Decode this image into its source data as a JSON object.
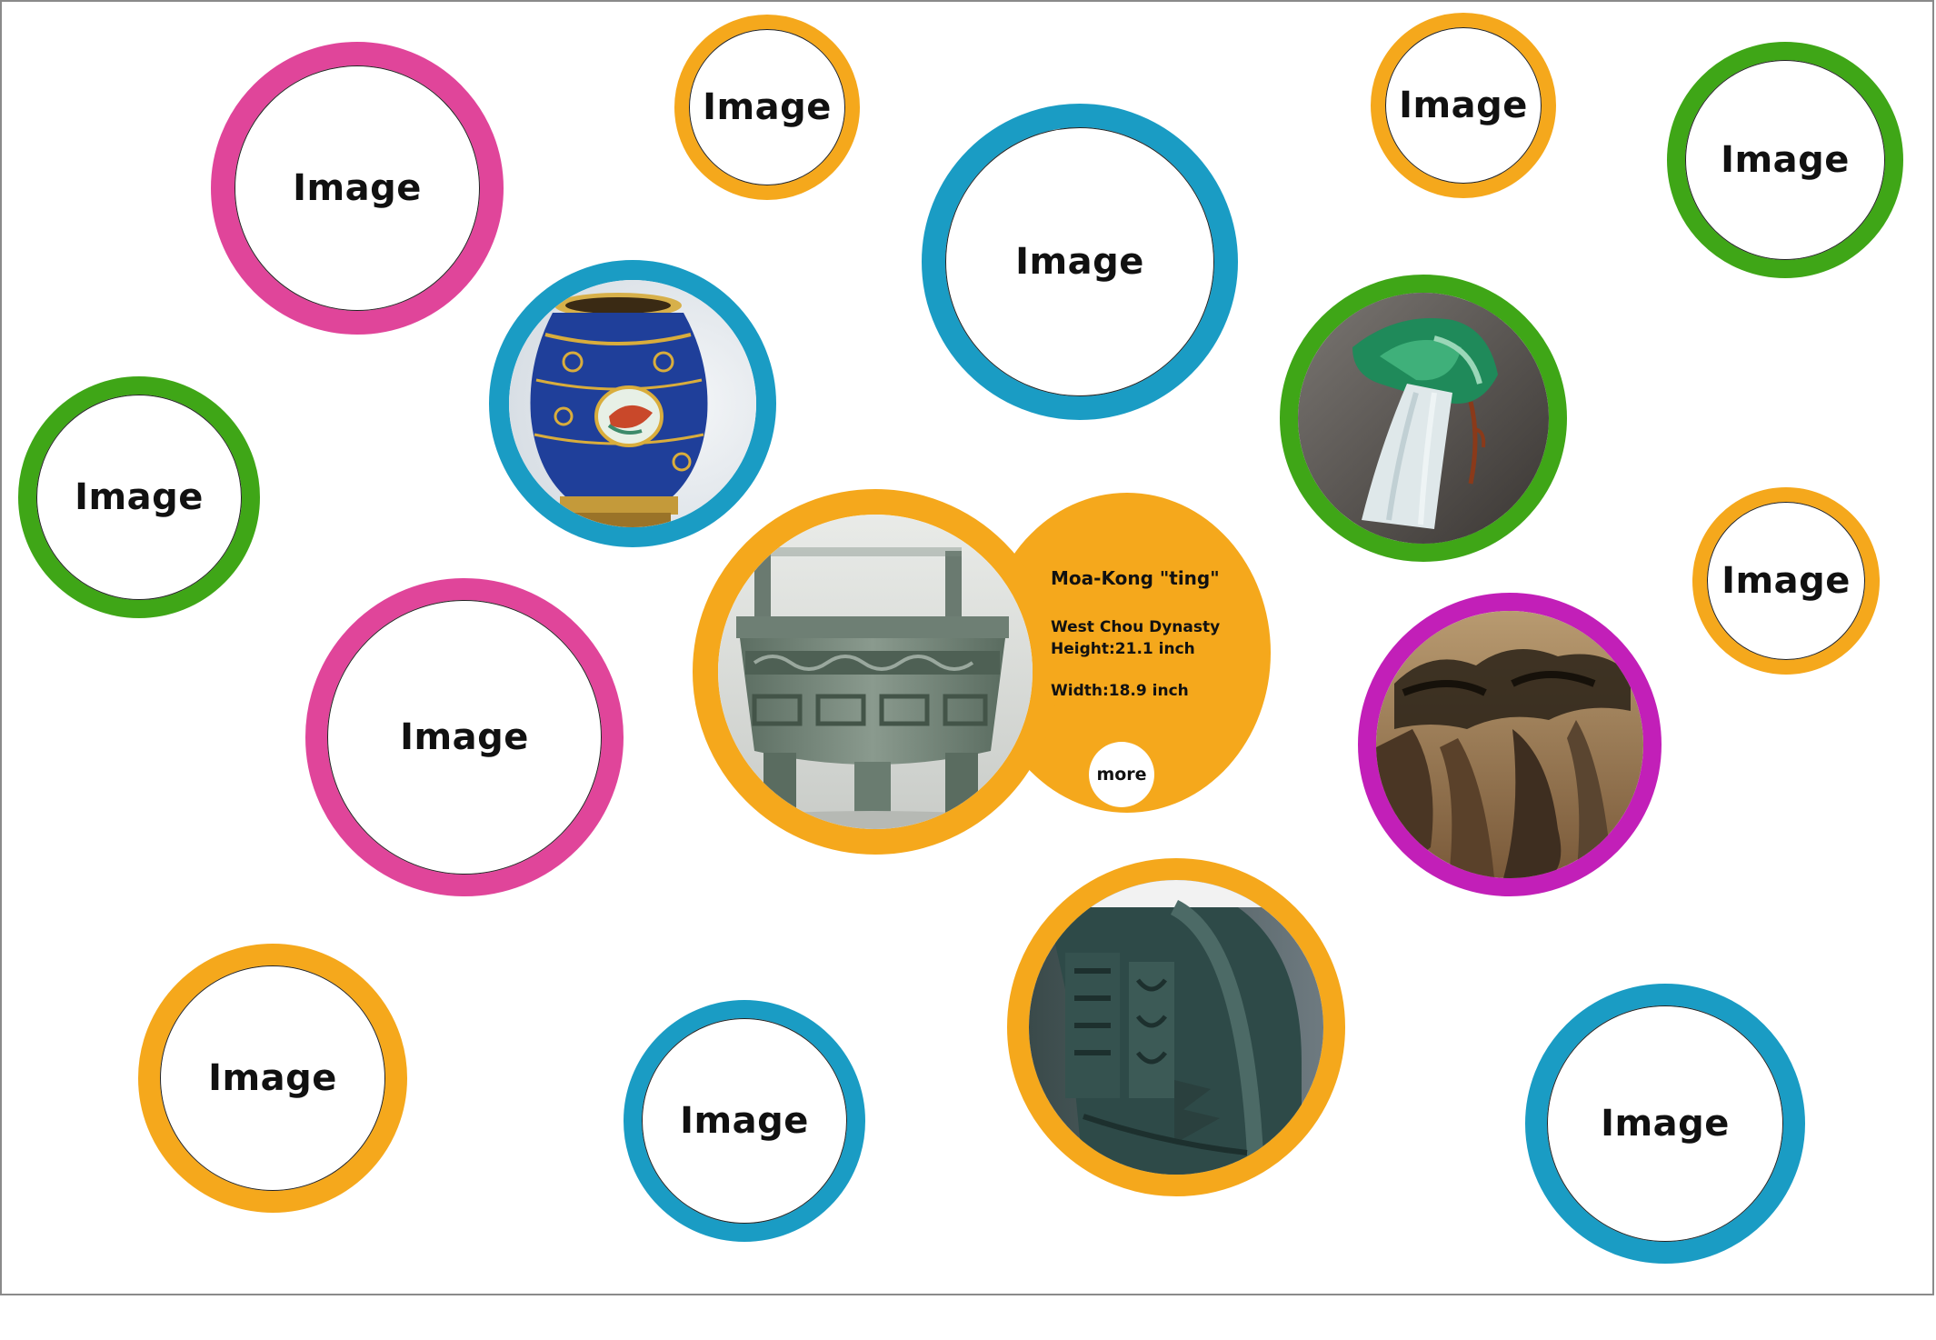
{
  "colors": {
    "pink": "#E0459A",
    "orange": "#F5A81C",
    "blue": "#1A9CC4",
    "green": "#3FA617",
    "purple": "#C21FB8",
    "frame": "#8a8a8a"
  },
  "placeholder_label": "Image",
  "placeholders": [
    {
      "id": "placeholder-1",
      "ring": "pink",
      "label": "Image"
    },
    {
      "id": "placeholder-2",
      "ring": "orange",
      "label": "Image"
    },
    {
      "id": "placeholder-3",
      "ring": "blue",
      "label": "Image"
    },
    {
      "id": "placeholder-4",
      "ring": "orange",
      "label": "Image"
    },
    {
      "id": "placeholder-5",
      "ring": "green",
      "label": "Image"
    },
    {
      "id": "placeholder-6",
      "ring": "green",
      "label": "Image"
    },
    {
      "id": "placeholder-7",
      "ring": "pink",
      "label": "Image"
    },
    {
      "id": "placeholder-8",
      "ring": "orange",
      "label": "Image"
    },
    {
      "id": "placeholder-9",
      "ring": "orange",
      "label": "Image"
    },
    {
      "id": "placeholder-10",
      "ring": "blue",
      "label": "Image"
    },
    {
      "id": "placeholder-11",
      "ring": "blue",
      "label": "Image"
    }
  ],
  "photos": [
    {
      "id": "photo-enamel-vase",
      "ring": "blue",
      "icon": "blue-enamel-vase"
    },
    {
      "id": "photo-jade-cabbage",
      "ring": "green",
      "icon": "jade-cabbage"
    },
    {
      "id": "photo-landscape-painting",
      "ring": "purple",
      "icon": "ink-landscape-painting"
    },
    {
      "id": "photo-bronze-vessel",
      "ring": "orange",
      "icon": "bronze-zun-vessel"
    }
  ],
  "featured": {
    "ring": "orange",
    "icon": "bronze-ding-cauldron",
    "title": "Moa-Kong \"ting\"",
    "dynasty": "West Chou Dynasty",
    "height": "Height:21.1 inch",
    "width": "Width:18.9 inch",
    "more_label": "more"
  }
}
